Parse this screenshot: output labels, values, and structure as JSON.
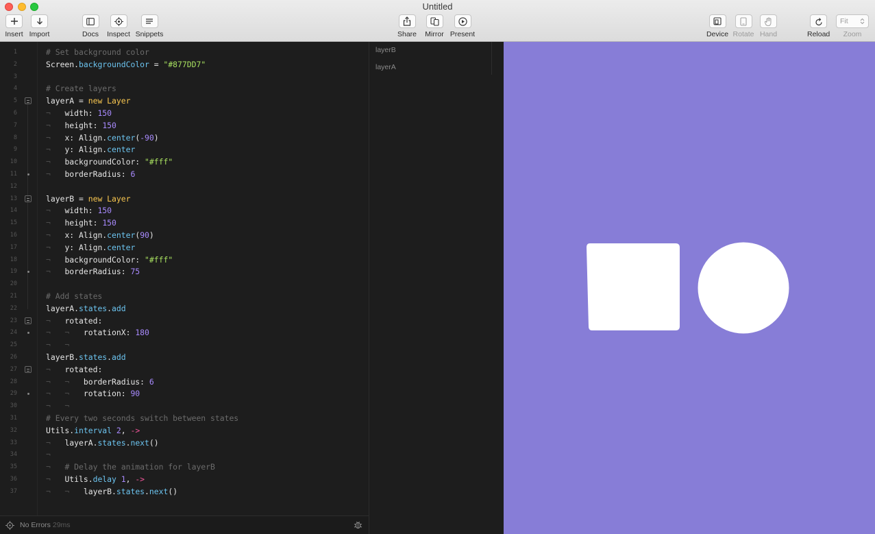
{
  "window": {
    "title": "Untitled"
  },
  "toolbar": {
    "insert": "Insert",
    "import": "Import",
    "docs": "Docs",
    "inspect": "Inspect",
    "snippets": "Snippets",
    "share": "Share",
    "mirror": "Mirror",
    "present": "Present",
    "device": "Device",
    "rotate": "Rotate",
    "hand": "Hand",
    "reload": "Reload",
    "zoom_label": "Zoom",
    "zoom_value": "Fit"
  },
  "editor": {
    "lines": [
      {
        "n": "1",
        "segs": [
          [
            "c-com",
            "# Set background color"
          ]
        ]
      },
      {
        "n": "2",
        "segs": [
          [
            "",
            "Screen."
          ],
          [
            "c-prop",
            "backgroundColor"
          ],
          [
            "",
            " = "
          ],
          [
            "c-str",
            "\"#877DD7\""
          ]
        ]
      },
      {
        "n": "3",
        "segs": []
      },
      {
        "n": "4",
        "segs": [
          [
            "c-com",
            "# Create layers"
          ]
        ]
      },
      {
        "n": "5",
        "fold": "open",
        "segs": [
          [
            "",
            "layerA = "
          ],
          [
            "c-kw",
            "new Layer"
          ]
        ]
      },
      {
        "n": "6",
        "segs": [
          [
            "c-ws",
            "¬   "
          ],
          [
            "",
            "width: "
          ],
          [
            "c-num",
            "150"
          ]
        ]
      },
      {
        "n": "7",
        "segs": [
          [
            "c-ws",
            "¬   "
          ],
          [
            "",
            "height: "
          ],
          [
            "c-num",
            "150"
          ]
        ]
      },
      {
        "n": "8",
        "segs": [
          [
            "c-ws",
            "¬   "
          ],
          [
            "",
            "x: Align."
          ],
          [
            "c-prop",
            "center"
          ],
          [
            "",
            "("
          ],
          [
            "c-num",
            "-90"
          ],
          [
            "",
            ")"
          ]
        ]
      },
      {
        "n": "9",
        "segs": [
          [
            "c-ws",
            "¬   "
          ],
          [
            "",
            "y: Align."
          ],
          [
            "c-prop",
            "center"
          ]
        ]
      },
      {
        "n": "10",
        "segs": [
          [
            "c-ws",
            "¬   "
          ],
          [
            "",
            "backgroundColor: "
          ],
          [
            "c-str",
            "\"#fff\""
          ]
        ]
      },
      {
        "n": "11",
        "fold": "end",
        "segs": [
          [
            "c-ws",
            "¬   "
          ],
          [
            "",
            "borderRadius: "
          ],
          [
            "c-num",
            "6"
          ]
        ]
      },
      {
        "n": "12",
        "segs": []
      },
      {
        "n": "13",
        "fold": "open",
        "segs": [
          [
            "",
            "layerB = "
          ],
          [
            "c-kw",
            "new Layer"
          ]
        ]
      },
      {
        "n": "14",
        "segs": [
          [
            "c-ws",
            "¬   "
          ],
          [
            "",
            "width: "
          ],
          [
            "c-num",
            "150"
          ]
        ]
      },
      {
        "n": "15",
        "segs": [
          [
            "c-ws",
            "¬   "
          ],
          [
            "",
            "height: "
          ],
          [
            "c-num",
            "150"
          ]
        ]
      },
      {
        "n": "16",
        "segs": [
          [
            "c-ws",
            "¬   "
          ],
          [
            "",
            "x: Align."
          ],
          [
            "c-prop",
            "center"
          ],
          [
            "",
            "("
          ],
          [
            "c-num",
            "90"
          ],
          [
            "",
            ")"
          ]
        ]
      },
      {
        "n": "17",
        "segs": [
          [
            "c-ws",
            "¬   "
          ],
          [
            "",
            "y: Align."
          ],
          [
            "c-prop",
            "center"
          ]
        ]
      },
      {
        "n": "18",
        "segs": [
          [
            "c-ws",
            "¬   "
          ],
          [
            "",
            "backgroundColor: "
          ],
          [
            "c-str",
            "\"#fff\""
          ]
        ]
      },
      {
        "n": "19",
        "fold": "end",
        "segs": [
          [
            "c-ws",
            "¬   "
          ],
          [
            "",
            "borderRadius: "
          ],
          [
            "c-num",
            "75"
          ]
        ]
      },
      {
        "n": "20",
        "segs": []
      },
      {
        "n": "21",
        "segs": [
          [
            "c-com",
            "# Add states"
          ]
        ]
      },
      {
        "n": "22",
        "segs": [
          [
            "",
            "layerA."
          ],
          [
            "c-prop",
            "states"
          ],
          [
            "",
            "."
          ],
          [
            "c-prop",
            "add"
          ]
        ]
      },
      {
        "n": "23",
        "fold": "open",
        "segs": [
          [
            "c-ws",
            "¬   "
          ],
          [
            "",
            "rotated:"
          ]
        ]
      },
      {
        "n": "24",
        "fold": "end",
        "segs": [
          [
            "c-ws",
            "¬   ¬   "
          ],
          [
            "",
            "rotationX: "
          ],
          [
            "c-num",
            "180"
          ]
        ]
      },
      {
        "n": "25",
        "segs": [
          [
            "c-ws",
            "¬   ¬"
          ]
        ]
      },
      {
        "n": "26",
        "segs": [
          [
            "",
            "layerB."
          ],
          [
            "c-prop",
            "states"
          ],
          [
            "",
            "."
          ],
          [
            "c-prop",
            "add"
          ]
        ]
      },
      {
        "n": "27",
        "fold": "open",
        "segs": [
          [
            "c-ws",
            "¬   "
          ],
          [
            "",
            "rotated:"
          ]
        ]
      },
      {
        "n": "28",
        "segs": [
          [
            "c-ws",
            "¬   ¬   "
          ],
          [
            "",
            "borderRadius: "
          ],
          [
            "c-num",
            "6"
          ]
        ]
      },
      {
        "n": "29",
        "fold": "end",
        "segs": [
          [
            "c-ws",
            "¬   ¬   "
          ],
          [
            "",
            "rotation: "
          ],
          [
            "c-num",
            "90"
          ]
        ]
      },
      {
        "n": "30",
        "segs": [
          [
            "c-ws",
            "¬   ¬"
          ]
        ]
      },
      {
        "n": "31",
        "segs": [
          [
            "c-com",
            "# Every two seconds switch between states"
          ]
        ]
      },
      {
        "n": "32",
        "segs": [
          [
            "",
            "Utils."
          ],
          [
            "c-prop",
            "interval"
          ],
          [
            "",
            " "
          ],
          [
            "c-num",
            "2"
          ],
          [
            "",
            ", "
          ],
          [
            "c-arrow",
            "->"
          ]
        ]
      },
      {
        "n": "33",
        "segs": [
          [
            "c-ws",
            "¬   "
          ],
          [
            "",
            "layerA."
          ],
          [
            "c-prop",
            "states"
          ],
          [
            "",
            "."
          ],
          [
            "c-prop",
            "next"
          ],
          [
            "",
            "()"
          ]
        ]
      },
      {
        "n": "34",
        "segs": [
          [
            "c-ws",
            "¬"
          ]
        ]
      },
      {
        "n": "35",
        "segs": [
          [
            "c-ws",
            "¬   "
          ],
          [
            "c-com",
            "# Delay the animation for layerB"
          ]
        ]
      },
      {
        "n": "36",
        "segs": [
          [
            "c-ws",
            "¬   "
          ],
          [
            "",
            "Utils."
          ],
          [
            "c-prop",
            "delay"
          ],
          [
            "",
            " "
          ],
          [
            "c-num",
            "1"
          ],
          [
            "",
            ", "
          ],
          [
            "c-arrow",
            "->"
          ]
        ]
      },
      {
        "n": "37",
        "segs": [
          [
            "c-ws",
            "¬   ¬   "
          ],
          [
            "",
            "layerB."
          ],
          [
            "c-prop",
            "states"
          ],
          [
            "",
            "."
          ],
          [
            "c-prop",
            "next"
          ],
          [
            "",
            "()"
          ]
        ]
      }
    ]
  },
  "status": {
    "errors": "No Errors",
    "time": "29ms"
  },
  "layers": {
    "items": [
      "layerB",
      "layerA"
    ]
  },
  "canvas": {
    "background": "#877DD7",
    "layer_color": "#ffffff"
  },
  "icons": [
    "plus-icon",
    "arrow-down-icon",
    "sidebar-icon",
    "target-icon",
    "snippets-icon",
    "share-icon",
    "mirror-icon",
    "play-icon",
    "device-icon",
    "rotate-icon",
    "hand-icon",
    "reload-icon",
    "chevron-updown-icon",
    "crosshair-icon",
    "bug-icon"
  ]
}
